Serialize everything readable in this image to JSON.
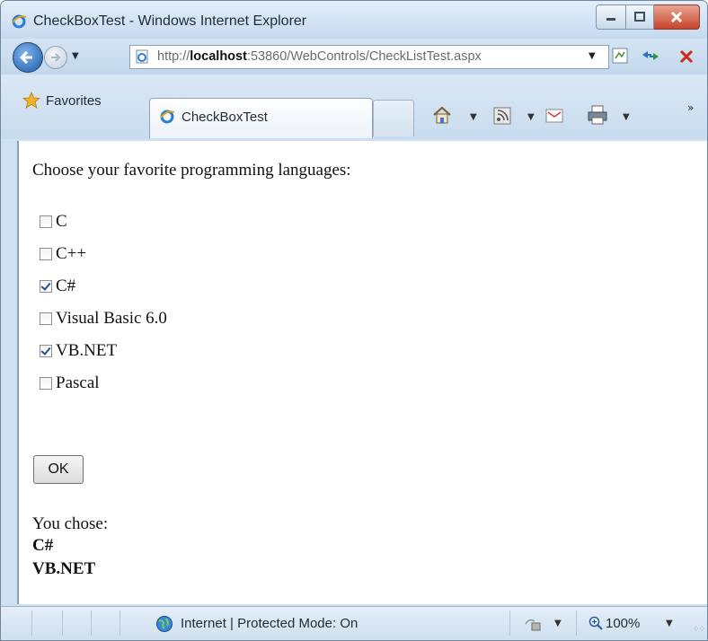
{
  "window": {
    "title": "CheckBoxTest - Windows Internet Explorer",
    "controls": {
      "minimize": "minimize",
      "maximize": "maximize",
      "close": "close"
    }
  },
  "address_bar": {
    "url_prefix": "http://",
    "url_host": "localhost",
    "url_suffix": ":53860/WebControls/CheckListTest.aspx"
  },
  "favorites_bar": {
    "favorites_label": "Favorites",
    "tab_title": "CheckBoxTest"
  },
  "page": {
    "prompt": "Choose your favorite programming languages:",
    "options": [
      {
        "label": "C",
        "checked": false
      },
      {
        "label": "C++",
        "checked": false
      },
      {
        "label": "C#",
        "checked": true
      },
      {
        "label": "Visual Basic 6.0",
        "checked": false
      },
      {
        "label": "VB.NET",
        "checked": true
      },
      {
        "label": "Pascal",
        "checked": false
      }
    ],
    "ok_label": "OK",
    "result_label": "You chose:",
    "results": [
      "C#",
      "VB.NET"
    ]
  },
  "status_bar": {
    "zone_text": "Internet | Protected Mode: On",
    "zoom": "100%"
  },
  "colors": {
    "accent": "#1e5aa8",
    "close_red": "#c7432b",
    "check": "#2b4f8f"
  }
}
